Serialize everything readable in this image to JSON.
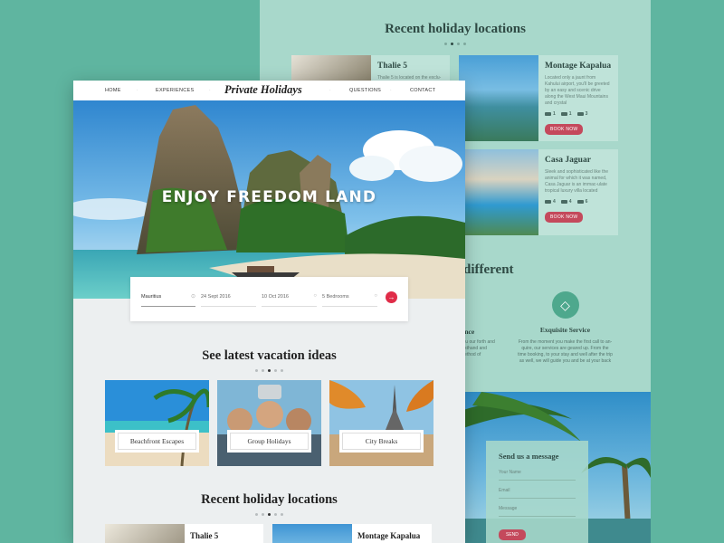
{
  "back_page": {
    "heading": "Recent holiday locations",
    "cards": [
      {
        "title": "Thalie 5",
        "desc": "Thalie 5 is located on the exclu-"
      },
      {
        "title": "Montage Kapalua",
        "desc": "Located only a jaunt from Kahului airport, you'll be greeted by an easy and scenic drive along the West Maui Mountains and crystal",
        "stats": [
          "1",
          "1",
          "3"
        ],
        "button": "BOOK NOW"
      },
      {
        "title": "Casa Jaguar",
        "desc": "Sleek and sophisticated like the animal for which it was named, Casa Jaguar is an immac-ulate tropical luxury villa located",
        "stats": [
          "4",
          "4",
          "6"
        ],
        "button": "BOOK NOW"
      }
    ],
    "different_title": "different",
    "experience_fragment": "ence",
    "experience_text": "you our forth and firsthand and method of",
    "exquisite_title": "Exquisite Service",
    "exquisite_text": "From the moment you make the first call to an-quire, our services are geared up. From the time booking, to your stay and well after the trip as well, we will guide you and be at your back",
    "message": {
      "title": "Send us a message",
      "name_placeholder": "Your Name",
      "email_placeholder": "Email",
      "message_placeholder": "Message",
      "send": "SEND"
    }
  },
  "front_page": {
    "nav": [
      "HOME",
      "EXPERIENCES",
      "QUESTIONS",
      "CONTACT"
    ],
    "logo": "Private Holidays",
    "hero_title": "ENJOY FREEDOM LAND",
    "search": {
      "destination": "Mauritius",
      "check_in": "24 Sept 2016",
      "check_out": "10 Oct 2016",
      "bedrooms": "5 Bedrooms"
    },
    "vacation_title": "See latest vacation ideas",
    "vacation_cards": [
      "Beachfront Escapes",
      "Group Holidays",
      "City Breaks"
    ],
    "recent_title": "Recent holiday locations",
    "recent_cards": [
      "Thalie 5",
      "Montage Kapalua"
    ]
  },
  "colors": {
    "background": "#5fb5a0",
    "accent": "#c4495c",
    "search_button": "#e02c48"
  }
}
